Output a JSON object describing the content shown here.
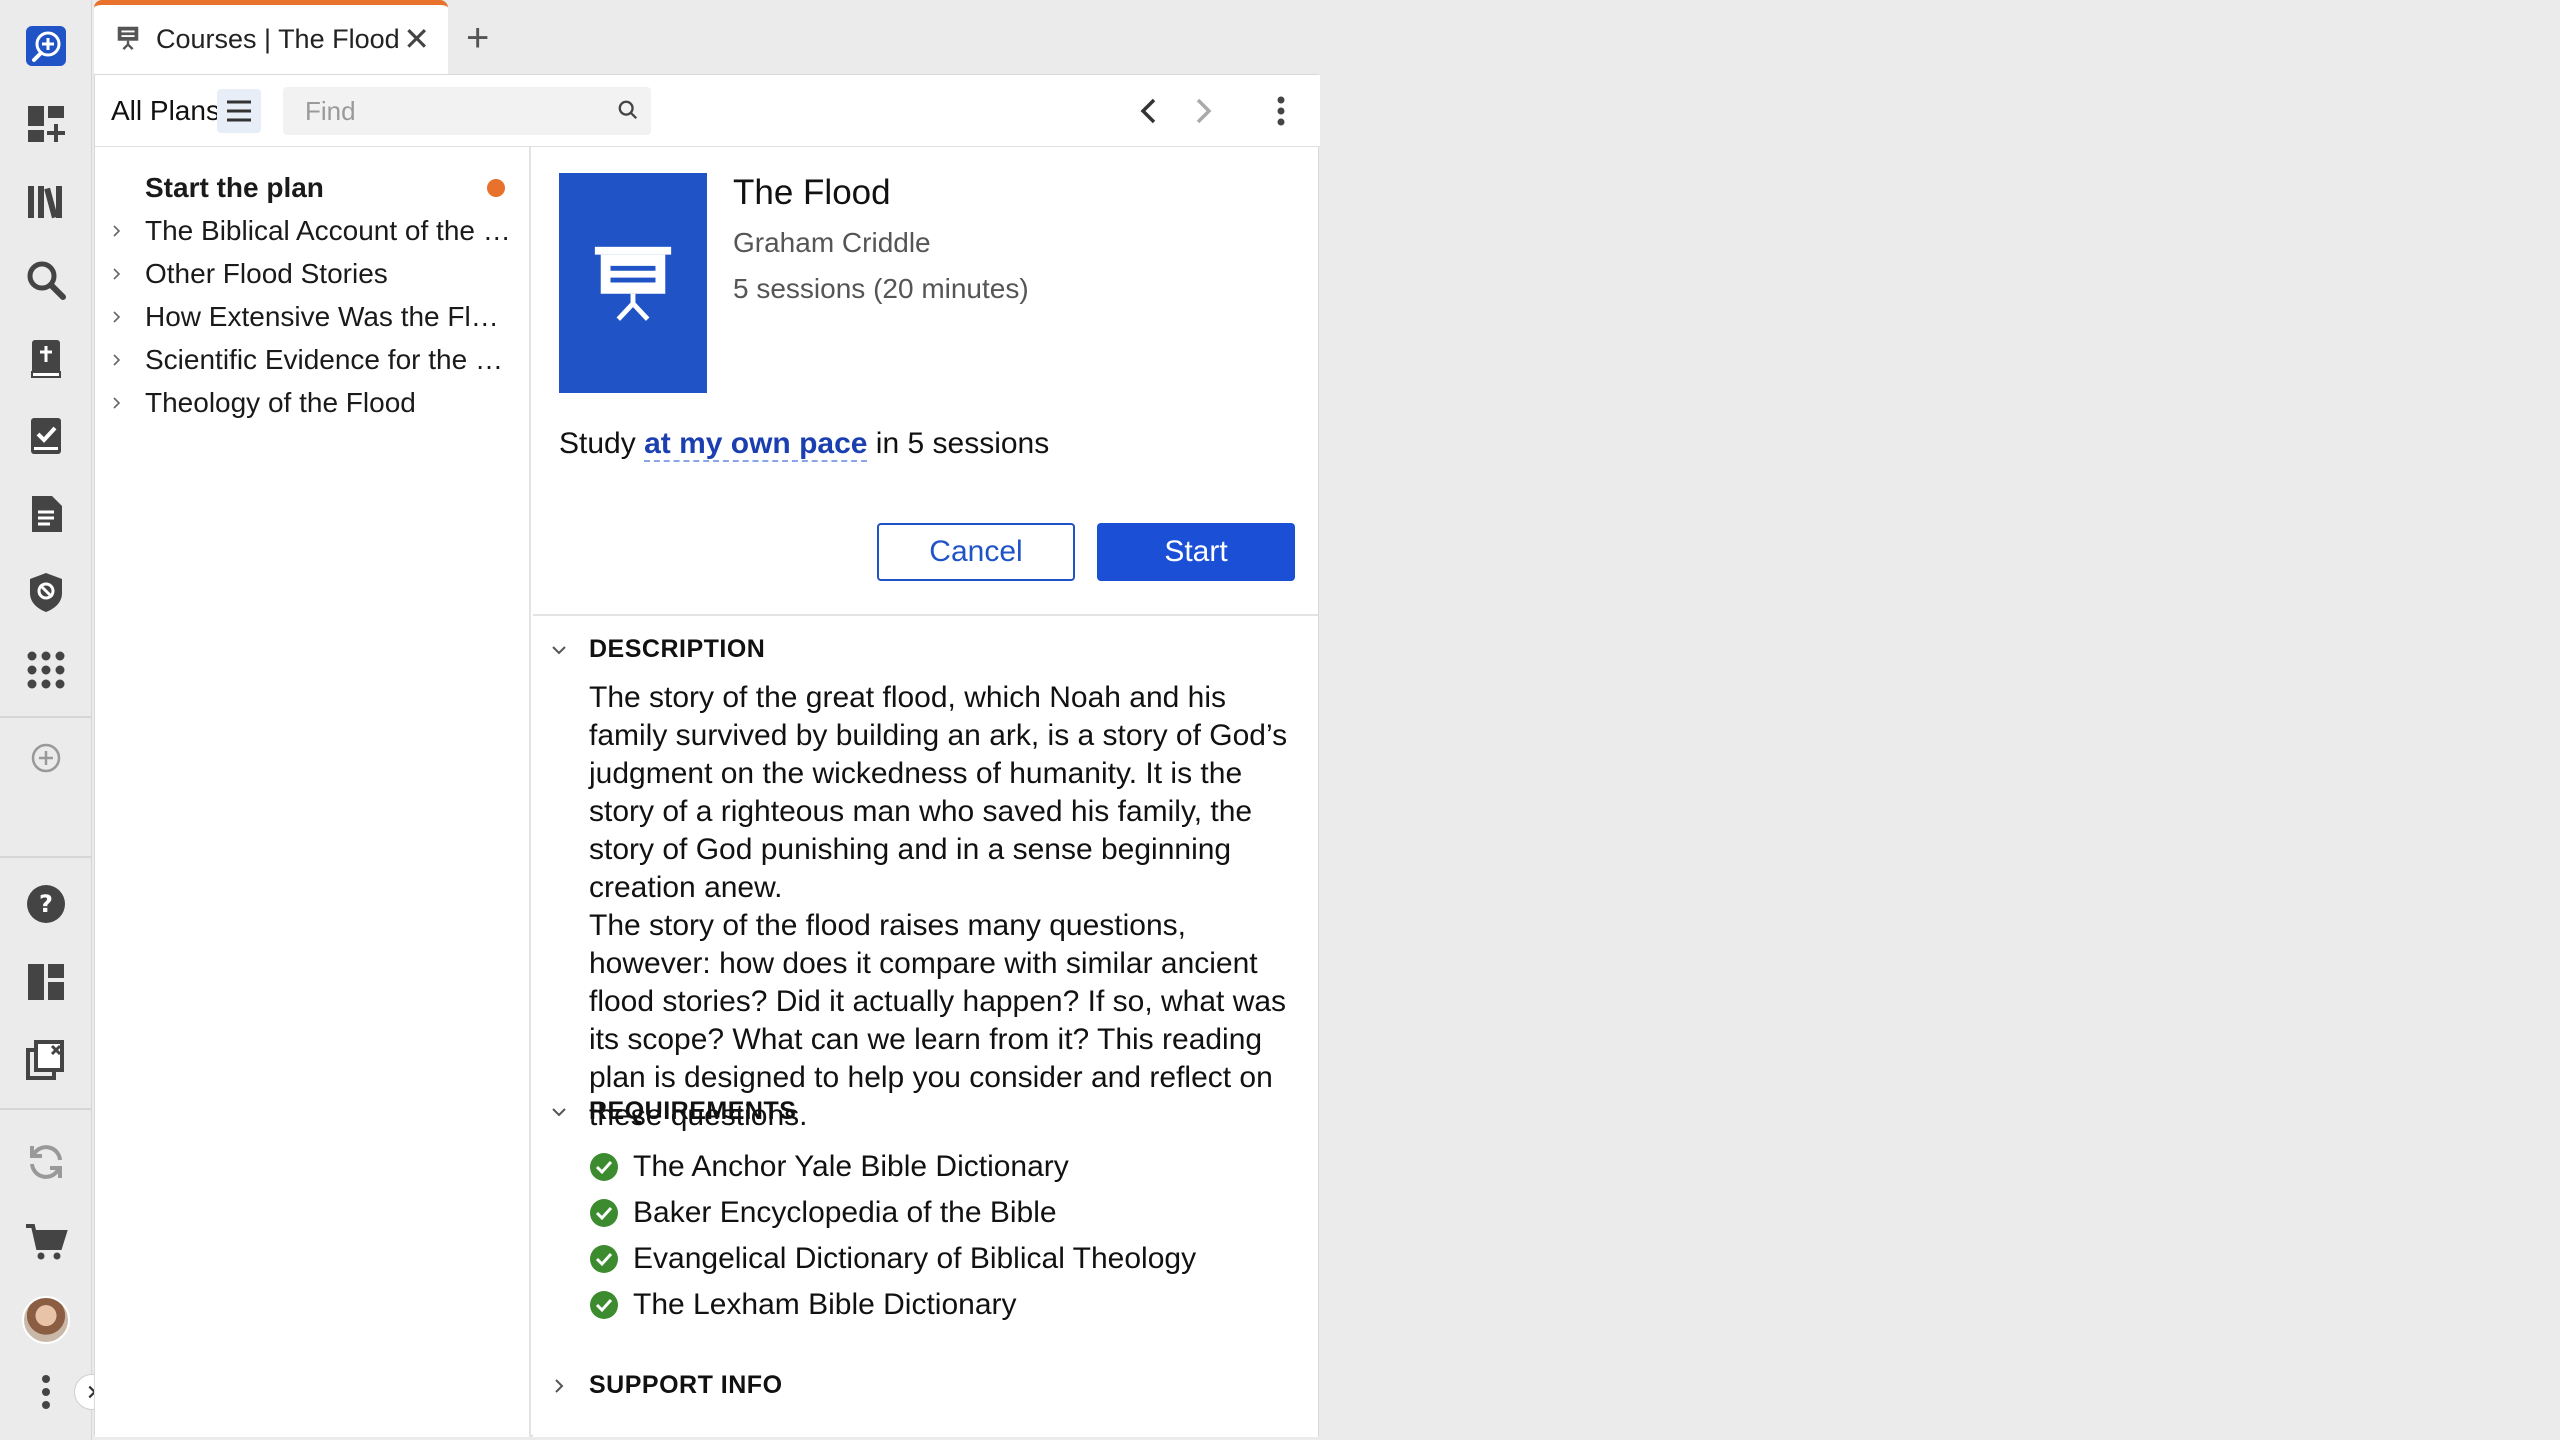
{
  "tab": {
    "title": "Courses | The Flood",
    "icon": "course-easel-icon"
  },
  "toolbar": {
    "all_plans_label": "All Plans",
    "find_placeholder": "Find"
  },
  "sidebar": {
    "items": [
      {
        "label": "Start the plan",
        "current": true
      },
      {
        "label": "The Biblical Account of the Flood"
      },
      {
        "label": "Other Flood Stories"
      },
      {
        "label": "How Extensive Was the Flood?"
      },
      {
        "label": "Scientific Evidence for the Flood"
      },
      {
        "label": "Theology of the Flood"
      }
    ]
  },
  "plan": {
    "title": "The Flood",
    "author": "Graham Criddle",
    "sessions": "5 sessions (20 minutes)",
    "study_prefix": "Study ",
    "study_link": "at my own pace",
    "study_suffix": " in 5 sessions",
    "cancel_label": "Cancel",
    "start_label": "Start"
  },
  "description": {
    "heading": "DESCRIPTION",
    "paragraphs": [
      "The story of the great flood, which Noah and his family survived by building an ark, is a story of God’s judgment on the wickedness of humanity. It is the story of a righteous man who saved his family, the story of God punishing and in a sense beginning creation anew.",
      "The story of the flood raises many questions, however: how does it compare with similar ancient flood stories? Did it actually happen? If so, what was its scope? What can we learn from it? This reading plan is designed to help you consider and reflect on these questions."
    ]
  },
  "requirements": {
    "heading": "REQUIREMENTS",
    "items": [
      "The Anchor Yale Bible Dictionary",
      "Baker Encyclopedia of the Bible",
      "Evangelical Dictionary of Biblical Theology",
      "The Lexham Bible Dictionary"
    ]
  },
  "support": {
    "heading": "SUPPORT INFO"
  },
  "colors": {
    "accent": "#1f53c6",
    "tab_indicator": "#e8722b",
    "check_green": "#3d8b2f"
  }
}
